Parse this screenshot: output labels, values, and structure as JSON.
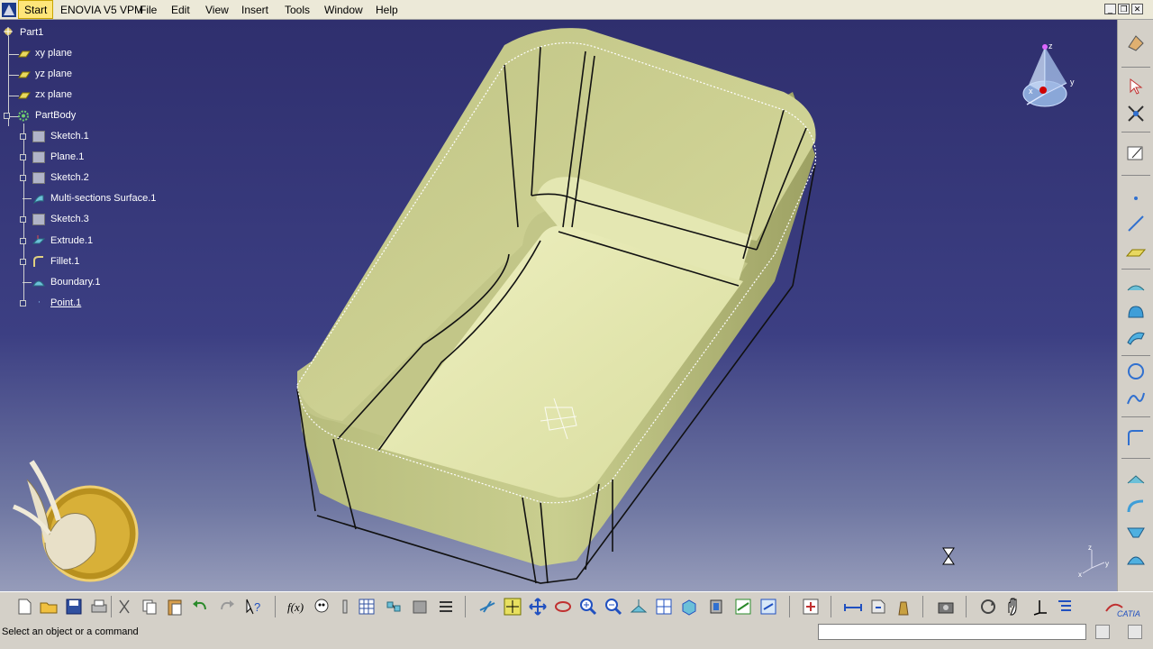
{
  "menubar": {
    "start": "Start",
    "items": [
      "ENOVIA V5 VPM",
      "File",
      "Edit",
      "View",
      "Insert",
      "Tools",
      "Window",
      "Help"
    ]
  },
  "window_buttons": {
    "minimize": "_",
    "restore": "❐",
    "close": "✕"
  },
  "tree": {
    "root": "Part1",
    "nodes": [
      {
        "label": "xy plane",
        "icon": "plane-icon"
      },
      {
        "label": "yz plane",
        "icon": "plane-icon"
      },
      {
        "label": "zx plane",
        "icon": "plane-icon"
      },
      {
        "label": "PartBody",
        "icon": "partbody-gear-icon"
      },
      {
        "label": "Sketch.1",
        "icon": "sketch-icon"
      },
      {
        "label": "Plane.1",
        "icon": "sketch-plane-icon"
      },
      {
        "label": "Sketch.2",
        "icon": "sketch-icon"
      },
      {
        "label": "Multi-sections Surface.1",
        "icon": "multi-section-surface-icon"
      },
      {
        "label": "Sketch.3",
        "icon": "sketch-icon"
      },
      {
        "label": "Extrude.1",
        "icon": "extrude-icon"
      },
      {
        "label": "Fillet.1",
        "icon": "fillet-icon"
      },
      {
        "label": "Boundary.1",
        "icon": "boundary-icon"
      },
      {
        "label": "Point.1",
        "icon": "point-icon"
      }
    ]
  },
  "compass": {
    "x": "x",
    "y": "y",
    "z": "z"
  },
  "mini_axis": {
    "z": "z",
    "x": "x",
    "y": "y"
  },
  "status": {
    "text": "Select an object or a command",
    "command_input": ""
  },
  "brand": {
    "catia": "CATIA"
  },
  "colors": {
    "viewport_top": "#2f2f6e",
    "viewport_bottom": "#969cba",
    "part_surface": "#cfd49a",
    "start_highlight": "#ffe67a"
  }
}
